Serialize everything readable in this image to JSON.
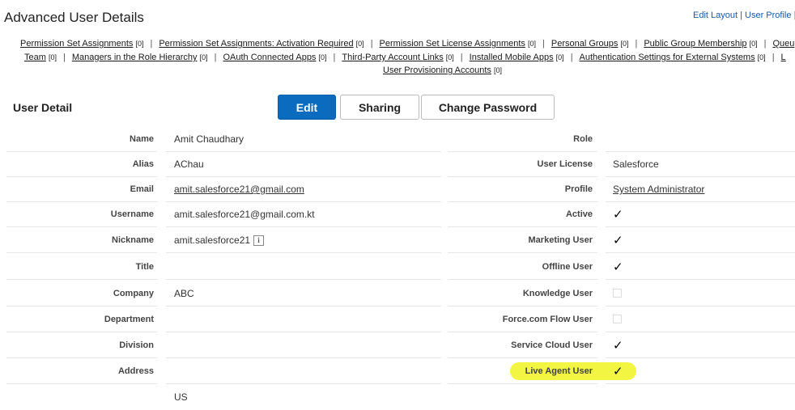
{
  "page": {
    "title": "Advanced User Details"
  },
  "toplinks": {
    "edit_layout": "Edit Layout",
    "sep": "|",
    "user_profile": "User Profile",
    "sep2": "|"
  },
  "related_lists": {
    "row1": [
      {
        "label": "Permission Set Assignments",
        "count": "[0]"
      },
      {
        "label": "Permission Set Assignments: Activation Required",
        "count": "[0]"
      },
      {
        "label": "Permission Set License Assignments",
        "count": "[0]"
      },
      {
        "label": "Personal Groups",
        "count": "[0]"
      },
      {
        "label": "Public Group Membership",
        "count": "[0]"
      },
      {
        "label": "Queu",
        "count": ""
      }
    ],
    "row2": [
      {
        "label": "Team",
        "count": "[0]"
      },
      {
        "label": "Managers in the Role Hierarchy",
        "count": "[0]"
      },
      {
        "label": "OAuth Connected Apps",
        "count": "[0]"
      },
      {
        "label": "Third-Party Account Links",
        "count": "[0]"
      },
      {
        "label": "Installed Mobile Apps",
        "count": "[0]"
      },
      {
        "label": "Authentication Settings for External Systems",
        "count": "[0]"
      },
      {
        "label": "L",
        "count": ""
      }
    ],
    "row3": [
      {
        "label": "User Provisioning Accounts",
        "count": "[0]"
      }
    ]
  },
  "section": {
    "title": "User Detail",
    "buttons": {
      "edit": "Edit",
      "sharing": "Sharing",
      "change_password": "Change Password"
    }
  },
  "left_fields": [
    {
      "label": "Name",
      "value": "Amit Chaudhary"
    },
    {
      "label": "Alias",
      "value": "AChau"
    },
    {
      "label": "Email",
      "value": "amit.salesforce21@gmail.com",
      "link": true
    },
    {
      "label": "Username",
      "value": "amit.salesforce21@gmail.com.kt"
    },
    {
      "label": "Nickname",
      "value": "amit.salesforce21",
      "info": "i"
    },
    {
      "label": "Title",
      "value": ""
    },
    {
      "label": "Company",
      "value": "ABC"
    },
    {
      "label": "Department",
      "value": ""
    },
    {
      "label": "Division",
      "value": ""
    },
    {
      "label": "Address",
      "value": ""
    }
  ],
  "right_fields": [
    {
      "label": "Role",
      "value": ""
    },
    {
      "label": "User License",
      "value": "Salesforce"
    },
    {
      "label": "Profile",
      "value": "System Administrator",
      "link": true
    },
    {
      "label": "Active",
      "checked": true
    },
    {
      "label": "Marketing User",
      "checked": true
    },
    {
      "label": "Offline User",
      "checked": true
    },
    {
      "label": "Knowledge User",
      "checked": false
    },
    {
      "label": "Force.com Flow User",
      "checked": false
    },
    {
      "label": "Service Cloud User",
      "checked": true
    },
    {
      "label": "Live Agent User",
      "checked": true
    }
  ],
  "address_partial": "US",
  "check_glyph": "✓",
  "colors": {
    "primary_button": "#0a6bbf",
    "highlight": "#f2f542",
    "link": "#1c5aa0"
  }
}
